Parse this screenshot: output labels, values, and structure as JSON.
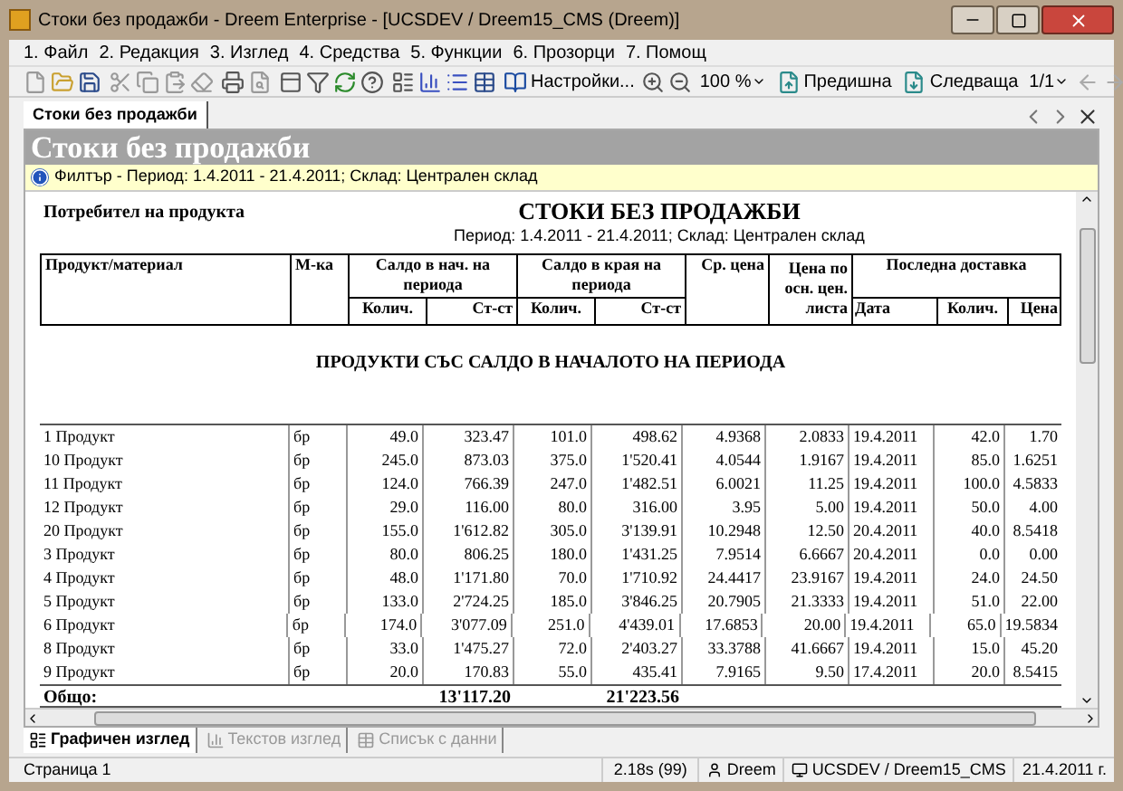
{
  "window": {
    "title": "Стоки без продажби - Dreem Enterprise - [UCSDEV / Dreem15_CMS (Dreem)]"
  },
  "menu": [
    "1. Файл",
    "2. Редакция",
    "3. Изглед",
    "4. Средства",
    "5. Функции",
    "6. Прозорци",
    "7. Помощ"
  ],
  "toolbar": {
    "settings": "Настройки...",
    "zoom": "100 %",
    "previous": "Предишна",
    "next": "Следваща",
    "page": "1/1"
  },
  "document_tab": {
    "label": "Стоки без продажби",
    "selected": true
  },
  "header": "Стоки без продажби",
  "filter": "Филтър - Период: 1.4.2011 - 21.4.2011; Склад: Централен склад",
  "report": {
    "left_title": "Потребител на продукта",
    "title": "СТОКИ БЕЗ ПРОДАЖБИ",
    "subtitle": "Период: 1.4.2011 - 21.4.2011; Склад: Централен склад",
    "columns": {
      "product": "Продукт/материал",
      "unit": "М-ка",
      "start": "Салдо в нач. на периода",
      "end": "Салдо в края на периода",
      "avg": "Ср. цена",
      "price": "Цена по осн. цен. листа",
      "last": "Последна доставка",
      "qty": "Колич.",
      "value": "Ст-ст",
      "qty2": "Колич.",
      "value2": "Ст-ст",
      "date": "Дата",
      "qty3": "Колич.",
      "price3": "Цена"
    },
    "section": "ПРОДУКТИ СЪС САЛДО В НАЧАЛОТО НА ПЕРИОДА",
    "rows": [
      [
        "1 Продукт",
        "бр",
        "49.0",
        "323.47",
        "101.0",
        "498.62",
        "4.9368",
        "2.0833",
        "19.4.2011",
        "42.0",
        "1.70"
      ],
      [
        "10 Продукт",
        "бр",
        "245.0",
        "873.03",
        "375.0",
        "1'520.41",
        "4.0544",
        "1.9167",
        "19.4.2011",
        "85.0",
        "1.6251"
      ],
      [
        "11 Продукт",
        "бр",
        "124.0",
        "766.39",
        "247.0",
        "1'482.51",
        "6.0021",
        "11.25",
        "19.4.2011",
        "100.0",
        "4.5833"
      ],
      [
        "12 Продукт",
        "бр",
        "29.0",
        "116.00",
        "80.0",
        "316.00",
        "3.95",
        "5.00",
        "19.4.2011",
        "50.0",
        "4.00"
      ],
      [
        "20 Продукт",
        "бр",
        "155.0",
        "1'612.82",
        "305.0",
        "3'139.91",
        "10.2948",
        "12.50",
        "20.4.2011",
        "40.0",
        "8.5418"
      ],
      [
        "3 Продукт",
        "бр",
        "80.0",
        "806.25",
        "180.0",
        "1'431.25",
        "7.9514",
        "6.6667",
        "20.4.2011",
        "0.0",
        "0.00"
      ],
      [
        "4 Продукт",
        "бр",
        "48.0",
        "1'171.80",
        "70.0",
        "1'710.92",
        "24.4417",
        "23.9167",
        "19.4.2011",
        "24.0",
        "24.50"
      ],
      [
        "5 Продукт",
        "бр",
        "133.0",
        "2'724.25",
        "185.0",
        "3'846.25",
        "20.7905",
        "21.3333",
        "19.4.2011",
        "51.0",
        "22.00"
      ],
      [
        "6 Продукт",
        "бр",
        "174.0",
        "3'077.09",
        "251.0",
        "4'439.01",
        "17.6853",
        "20.00",
        "19.4.2011",
        "65.0",
        "19.5834"
      ],
      [
        "8 Продукт",
        "бр",
        "33.0",
        "1'475.27",
        "72.0",
        "2'403.27",
        "33.3788",
        "41.6667",
        "19.4.2011",
        "15.0",
        "45.20"
      ],
      [
        "9 Продукт",
        "бр",
        "20.0",
        "170.83",
        "55.0",
        "435.41",
        "7.9165",
        "9.50",
        "17.4.2011",
        "20.0",
        "8.5415"
      ]
    ],
    "total": {
      "label": "Общо:",
      "start_value": "13'117.20",
      "end_value": "21'223.56"
    }
  },
  "view_tabs": [
    {
      "label": "Графичен изглед",
      "selected": true
    },
    {
      "label": "Текстов изглед",
      "selected": false
    },
    {
      "label": "Списък с данни",
      "selected": false
    }
  ],
  "status_bar": {
    "page": "Страница 1",
    "timing": "2.18s (99)",
    "user": "Dreem",
    "connection": "UCSDEV / Dreem15_CMS",
    "date": "21.4.2011 г."
  }
}
